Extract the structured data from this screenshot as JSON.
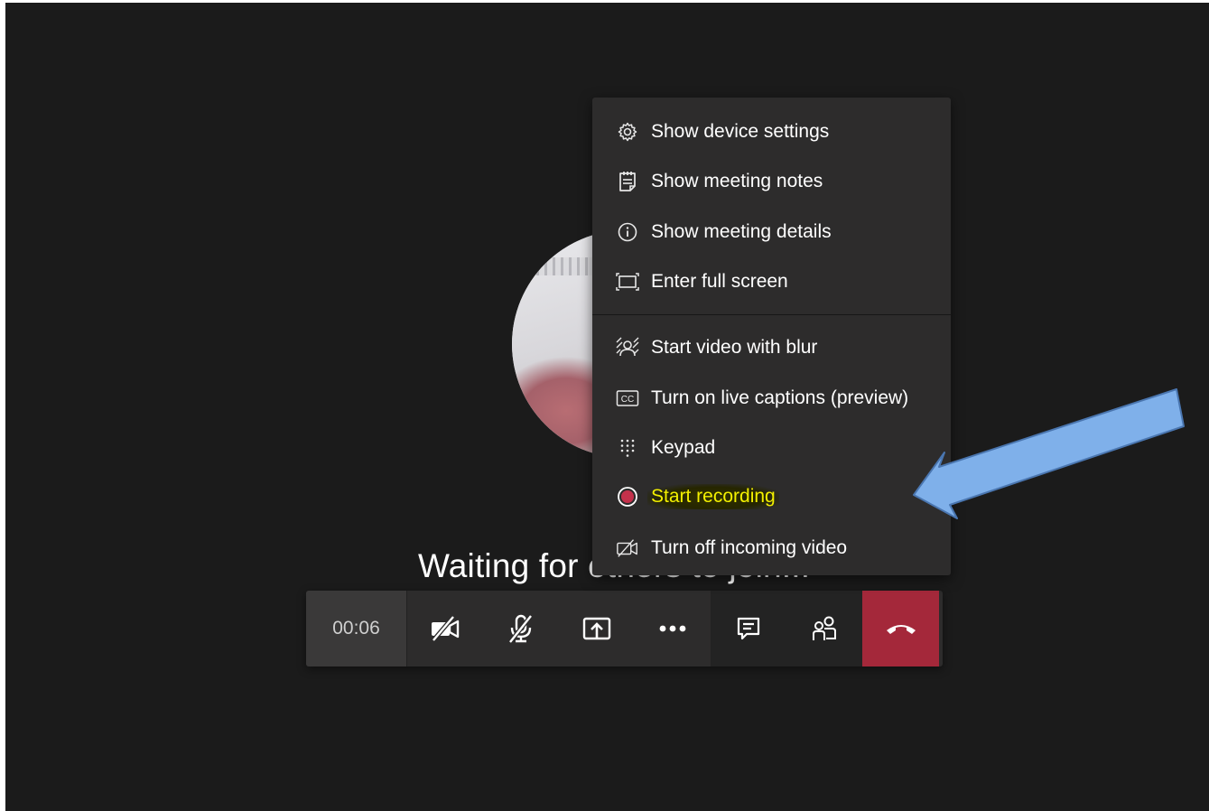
{
  "call": {
    "timer": "00:06",
    "waiting_text": "Waiting for others to join..."
  },
  "menu": {
    "items": [
      {
        "label": "Show device settings",
        "icon": "gear-icon"
      },
      {
        "label": "Show meeting notes",
        "icon": "notes-icon"
      },
      {
        "label": "Show meeting details",
        "icon": "info-icon"
      },
      {
        "label": "Enter full screen",
        "icon": "fullscreen-icon"
      },
      {
        "label": "Start video with blur",
        "icon": "blur-icon"
      },
      {
        "label": "Turn on live captions (preview)",
        "icon": "captions-icon"
      },
      {
        "label": "Keypad",
        "icon": "keypad-icon"
      },
      {
        "label": "Start recording",
        "icon": "record-icon"
      },
      {
        "label": "Turn off incoming video",
        "icon": "video-off-icon"
      }
    ],
    "captions_icon_text": "CC"
  },
  "toolbar": {
    "buttons": [
      "camera-off-icon",
      "mic-off-icon",
      "share-screen-icon",
      "more-icon",
      "chat-icon",
      "participants-icon",
      "hang-up-icon"
    ]
  },
  "colors": {
    "background": "#1b1b1b",
    "menu": "#2d2c2c",
    "highlight_text": "#f3f000",
    "record_dot": "#c4314b",
    "hangup": "#a4283a",
    "annotation_arrow": "#7fb0ea"
  }
}
